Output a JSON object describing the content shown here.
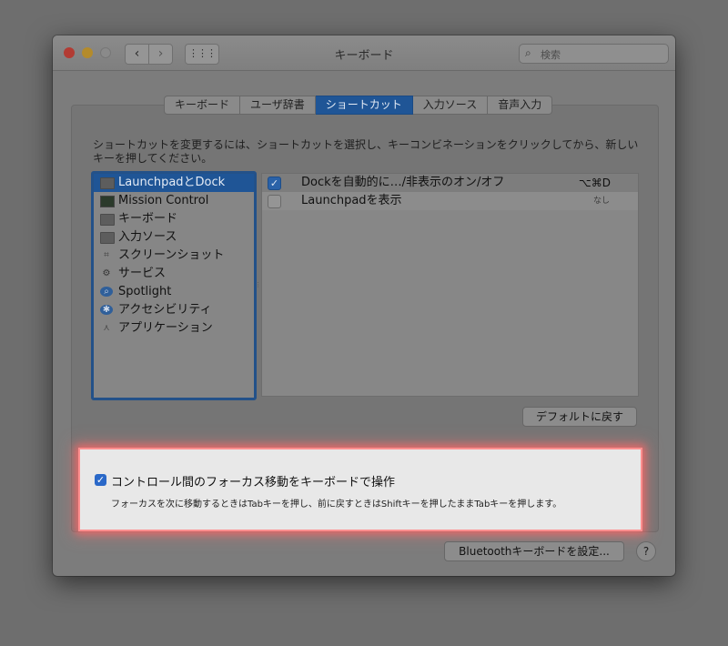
{
  "window": {
    "title": "キーボード",
    "search_placeholder": "検索"
  },
  "nav": {
    "back": "‹",
    "forward": "›",
    "grid": "⋮⋮⋮"
  },
  "tabs": [
    {
      "label": "キーボード"
    },
    {
      "label": "ユーザ辞書"
    },
    {
      "label": "ショートカット"
    },
    {
      "label": "入力ソース"
    },
    {
      "label": "音声入力"
    }
  ],
  "instruction": "ショートカットを変更するには、ショートカットを選択し、キーコンビネーションをクリックしてから、新しいキーを押してください。",
  "categories": [
    {
      "label": "LaunchpadとDock"
    },
    {
      "label": "Mission Control"
    },
    {
      "label": "キーボード"
    },
    {
      "label": "入力ソース"
    },
    {
      "label": "スクリーンショット"
    },
    {
      "label": "サービス"
    },
    {
      "label": "Spotlight"
    },
    {
      "label": "アクセシビリティ"
    },
    {
      "label": "アプリケーション"
    }
  ],
  "shortcuts": [
    {
      "label": "Dockを自動的に…/非表示のオン/オフ",
      "key": "⌥⌘D",
      "checked": true
    },
    {
      "label": "Launchpadを表示",
      "key": "なし",
      "checked": false
    }
  ],
  "buttons": {
    "restore_default": "デフォルトに戻す",
    "bluetooth": "Bluetoothキーボードを設定...",
    "help": "?"
  },
  "focus_option": {
    "title": "コントロール間のフォーカス移動をキーボードで操作",
    "description": "フォーカスを次に移動するときはTabキーを押し、前に戻すときはShiftキーを押したままTabキーを押します。",
    "checked": true
  },
  "colors": {
    "accent": "#1f5596",
    "highlight_border": "#ff8f8f"
  }
}
